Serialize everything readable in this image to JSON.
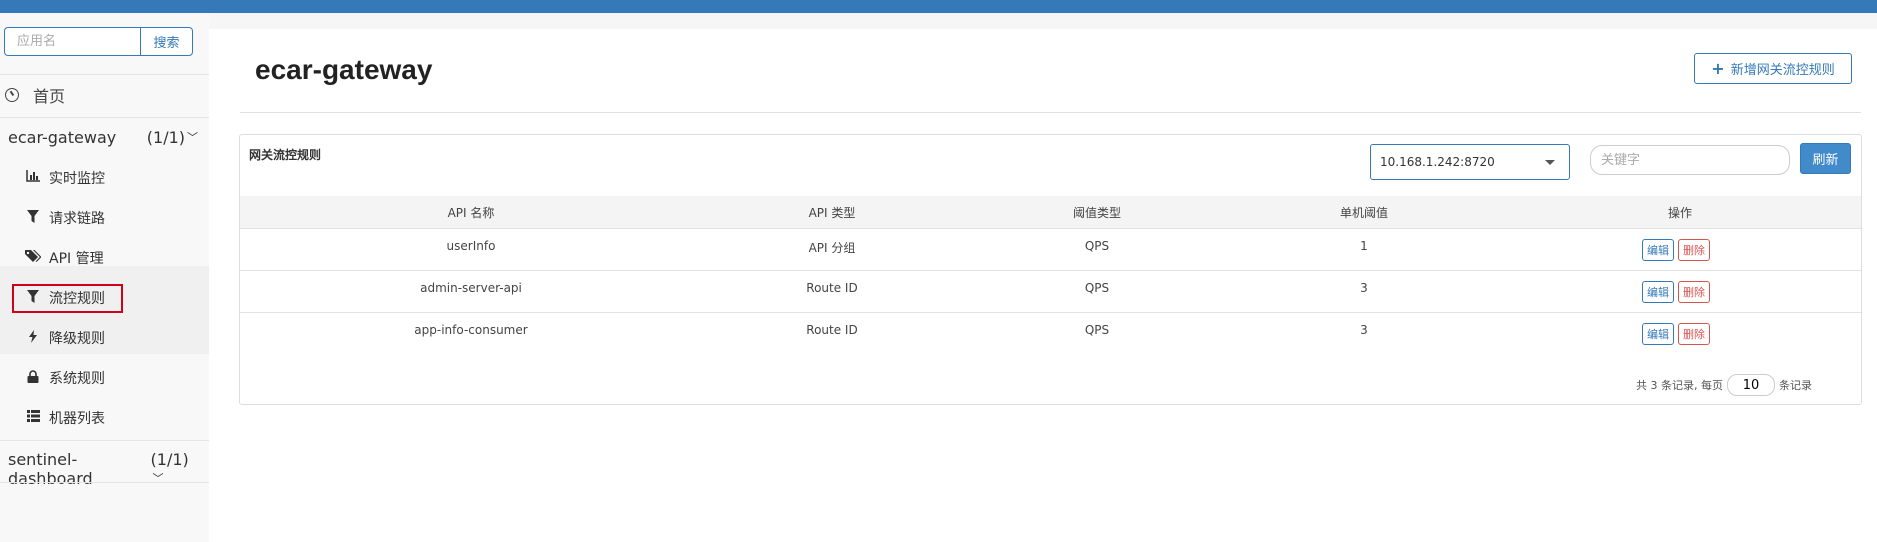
{
  "sidebar": {
    "search": {
      "placeholder": "应用名",
      "button": "搜索"
    },
    "home": {
      "icon": "dashboard-icon",
      "label": "首页"
    },
    "apps": [
      {
        "name": "ecar-gateway",
        "count": "(1/1)",
        "expanded": true,
        "items": [
          {
            "icon": "bar-chart-icon",
            "label": "实时监控"
          },
          {
            "icon": "filter-icon",
            "label": "请求链路"
          },
          {
            "icon": "tags-icon",
            "label": "API 管理"
          },
          {
            "icon": "filter-icon",
            "label": "流控规则",
            "active": true
          },
          {
            "icon": "flash-icon",
            "label": "降级规则"
          },
          {
            "icon": "lock-icon",
            "label": "系统规则"
          },
          {
            "icon": "list-icon",
            "label": "机器列表"
          }
        ]
      },
      {
        "name": "sentinel-dashboard",
        "count": "(1/1)",
        "expanded": false
      }
    ]
  },
  "header": {
    "title": "ecar-gateway",
    "add_button": "新增网关流控规则"
  },
  "panel": {
    "title": "网关流控规则",
    "machine_select": "10.168.1.242:8720",
    "keyword_placeholder": "关键字",
    "refresh_button": "刷新",
    "columns": [
      "API 名称",
      "API 类型",
      "阈值类型",
      "单机阈值",
      "操作"
    ],
    "rows": [
      {
        "api_name": "userInfo",
        "api_type": "API 分组",
        "threshold_type": "QPS",
        "threshold": "1"
      },
      {
        "api_name": "admin-server-api",
        "api_type": "Route ID",
        "threshold_type": "QPS",
        "threshold": "3"
      },
      {
        "api_name": "app-info-consumer",
        "api_type": "Route ID",
        "threshold_type": "QPS",
        "threshold": "3"
      }
    ],
    "row_actions": {
      "edit": "编辑",
      "delete": "删除"
    },
    "pagination": {
      "prefix": "共 3 条记录, 每页",
      "page_size": "10",
      "suffix": "条记录"
    }
  },
  "colors": {
    "primary": "#3579b8",
    "danger": "#d9534f",
    "highlight": "#d0021b"
  }
}
